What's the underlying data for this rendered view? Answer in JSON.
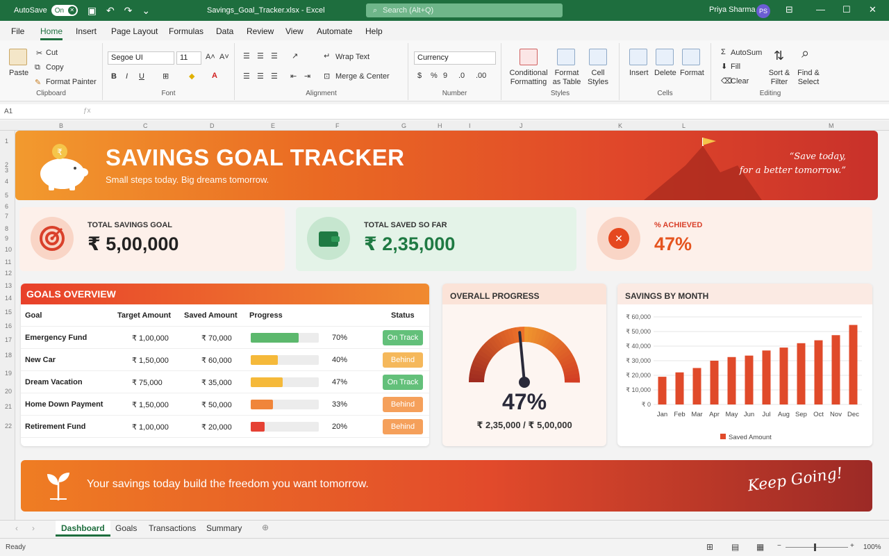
{
  "titlebar": {
    "autosave_label": "AutoSave",
    "autosave_state": "On",
    "filename": "Savings_Goal_Tracker.xlsx - Excel",
    "search_placeholder": "Search (Alt+Q)",
    "user_name": "Priya Sharma",
    "user_initials": "PS"
  },
  "menu": [
    "File",
    "Home",
    "Insert",
    "Page Layout",
    "Formulas",
    "Data",
    "Review",
    "View",
    "Automate",
    "Help"
  ],
  "ribbon": {
    "clipboard": {
      "paste": "Paste",
      "cut": "Cut",
      "copy": "Copy",
      "format_painter": "Format Painter",
      "label": "Clipboard"
    },
    "font": {
      "name": "Segoe UI",
      "size": "11",
      "label": "Font"
    },
    "alignment": {
      "wrap": "Wrap Text",
      "merge": "Merge & Center",
      "label": "Alignment"
    },
    "number": {
      "format": "Currency",
      "label": "Number"
    },
    "styles": {
      "cond": "Conditional Formatting",
      "table": "Format as Table",
      "cell": "Cell Styles",
      "label": "Styles"
    },
    "cells": {
      "insert": "Insert",
      "delete": "Delete",
      "format": "Format",
      "label": "Cells"
    },
    "editing": {
      "autosum": "AutoSum",
      "fill": "Fill",
      "clear": "Clear",
      "sort": "Sort & Filter",
      "find": "Find & Select",
      "label": "Editing"
    }
  },
  "namebox": "A1",
  "columns": [
    "B",
    "C",
    "D",
    "E",
    "F",
    "G",
    "H",
    "I",
    "J",
    "K",
    "L",
    "M"
  ],
  "rows": [
    "1",
    "2",
    "3",
    "4",
    "5",
    "6",
    "7",
    "8",
    "9",
    "10",
    "11",
    "12",
    "13",
    "14",
    "15",
    "16",
    "17",
    "18",
    "19",
    "20",
    "21",
    "22"
  ],
  "banner": {
    "title": "SAVINGS GOAL TRACKER",
    "subtitle": "Small steps today. Big dreams tomorrow.",
    "quote_line1": "“Save today,",
    "quote_line2": "for a better tomorrow.”"
  },
  "kpis": {
    "goal": {
      "label": "TOTAL SAVINGS GOAL",
      "value": "₹ 5,00,000"
    },
    "saved": {
      "label": "TOTAL SAVED SO FAR",
      "value": "₹ 2,35,000"
    },
    "achieved": {
      "label": "% ACHIEVED",
      "value": "47%"
    }
  },
  "goals": {
    "title": "GOALS OVERVIEW",
    "headers": [
      "Goal",
      "Target Amount",
      "Saved Amount",
      "Progress",
      "Status"
    ],
    "rows": [
      {
        "goal": "Emergency Fund",
        "target": "₹ 1,00,000",
        "saved": "₹ 70,000",
        "pct": "70%",
        "progress": 0.7,
        "status": "On Track",
        "bar_color": "#5cb86d",
        "status_color": "#63c07a"
      },
      {
        "goal": "New Car",
        "target": "₹ 1,50,000",
        "saved": "₹ 60,000",
        "pct": "40%",
        "progress": 0.4,
        "status": "Behind",
        "bar_color": "#f5b93a",
        "status_color": "#f5b85b"
      },
      {
        "goal": "Dream Vacation",
        "target": "₹ 75,000",
        "saved": "₹ 35,000",
        "pct": "47%",
        "progress": 0.47,
        "status": "On Track",
        "bar_color": "#f5b93a",
        "status_color": "#63c07a"
      },
      {
        "goal": "Home Down Payment",
        "target": "₹ 1,50,000",
        "saved": "₹ 50,000",
        "pct": "33%",
        "progress": 0.33,
        "status": "Behind",
        "bar_color": "#f0853a",
        "status_color": "#f5a05b"
      },
      {
        "goal": "Retirement Fund",
        "target": "₹ 1,00,000",
        "saved": "₹ 20,000",
        "pct": "20%",
        "progress": 0.2,
        "status": "Behind",
        "bar_color": "#e54134",
        "status_color": "#f5a05b"
      }
    ]
  },
  "overall": {
    "title": "OVERALL PROGRESS",
    "value": 0.47,
    "pct_text": "47%",
    "detail": "₹ 2,35,000 / ₹ 5,00,000"
  },
  "chart_data": {
    "type": "bar",
    "title": "SAVINGS BY MONTH",
    "categories": [
      "Jan",
      "Feb",
      "Mar",
      "Apr",
      "May",
      "Jun",
      "Jul",
      "Aug",
      "Sep",
      "Oct",
      "Nov",
      "Dec"
    ],
    "series": [
      {
        "name": "Saved Amount",
        "values": [
          19000,
          22000,
          25000,
          30000,
          32500,
          33500,
          37000,
          39000,
          42000,
          44000,
          47500,
          54500
        ]
      }
    ],
    "ylim": [
      0,
      60000
    ],
    "yticks": [
      "₹ 0",
      "₹ 10,000",
      "₹ 20,000",
      "₹ 30,000",
      "₹ 40,000",
      "₹ 50,000",
      "₹ 60,000"
    ],
    "legend": "bottom",
    "color": "#e04a2a"
  },
  "footer": {
    "message": "Your savings today build the freedom you want tomorrow.",
    "slogan": "Keep Going!"
  },
  "sheets": [
    "Dashboard",
    "Goals",
    "Transactions",
    "Summary"
  ],
  "status": {
    "ready": "Ready",
    "zoom": "100%"
  }
}
